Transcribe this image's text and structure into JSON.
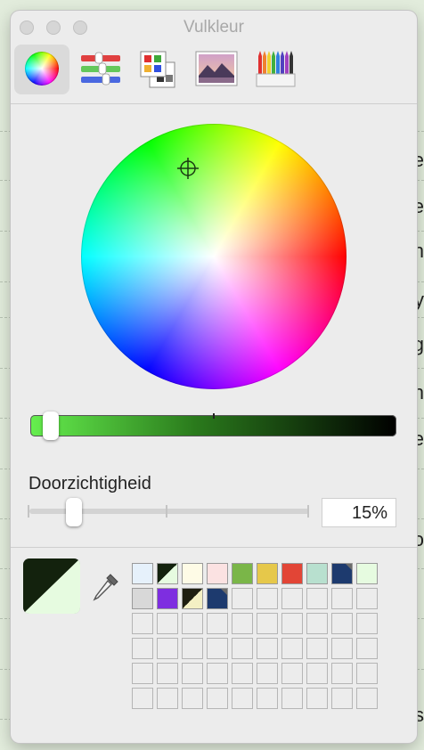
{
  "window": {
    "title": "Vulkleur"
  },
  "toolbar": {
    "tools": [
      {
        "name": "color-wheel",
        "active": true
      },
      {
        "name": "color-sliders",
        "active": false
      },
      {
        "name": "color-palettes",
        "active": false
      },
      {
        "name": "image-palettes",
        "active": false
      },
      {
        "name": "pencils",
        "active": false
      }
    ]
  },
  "brightness_slider": {
    "value_fraction": 0.05
  },
  "opacity": {
    "label": "Doorzichtigheid",
    "value": "15%",
    "value_fraction": 0.15
  },
  "current_color": {
    "top_left": "#13220d",
    "bottom_right": "#e6fbe0"
  },
  "background_fragments": [
    "e",
    "te",
    "n",
    "y",
    "g",
    "n",
    "re",
    "o",
    "s"
  ],
  "swatches": {
    "row1": [
      {
        "color": "#e6f1fb"
      },
      {
        "color": "split",
        "a": "#13220d",
        "b": "#e6fbe0"
      },
      {
        "color": "#fefbe6"
      },
      {
        "color": "#fbe2e2"
      },
      {
        "color": "#7ab648"
      },
      {
        "color": "#e6c84a"
      },
      {
        "color": "#e24536"
      },
      {
        "color": "#b8e0cf"
      },
      {
        "color": "#1d3a6e",
        "marker": true
      },
      {
        "color": "#e6fbe0"
      }
    ],
    "row2": [
      {
        "color": "#d8d8d8"
      },
      {
        "color": "#7e2ee0"
      },
      {
        "color": "split",
        "a": "#1e1e10",
        "b": "#f4f0c4"
      },
      {
        "color": "#1d3a6e",
        "marker": true
      }
    ]
  }
}
